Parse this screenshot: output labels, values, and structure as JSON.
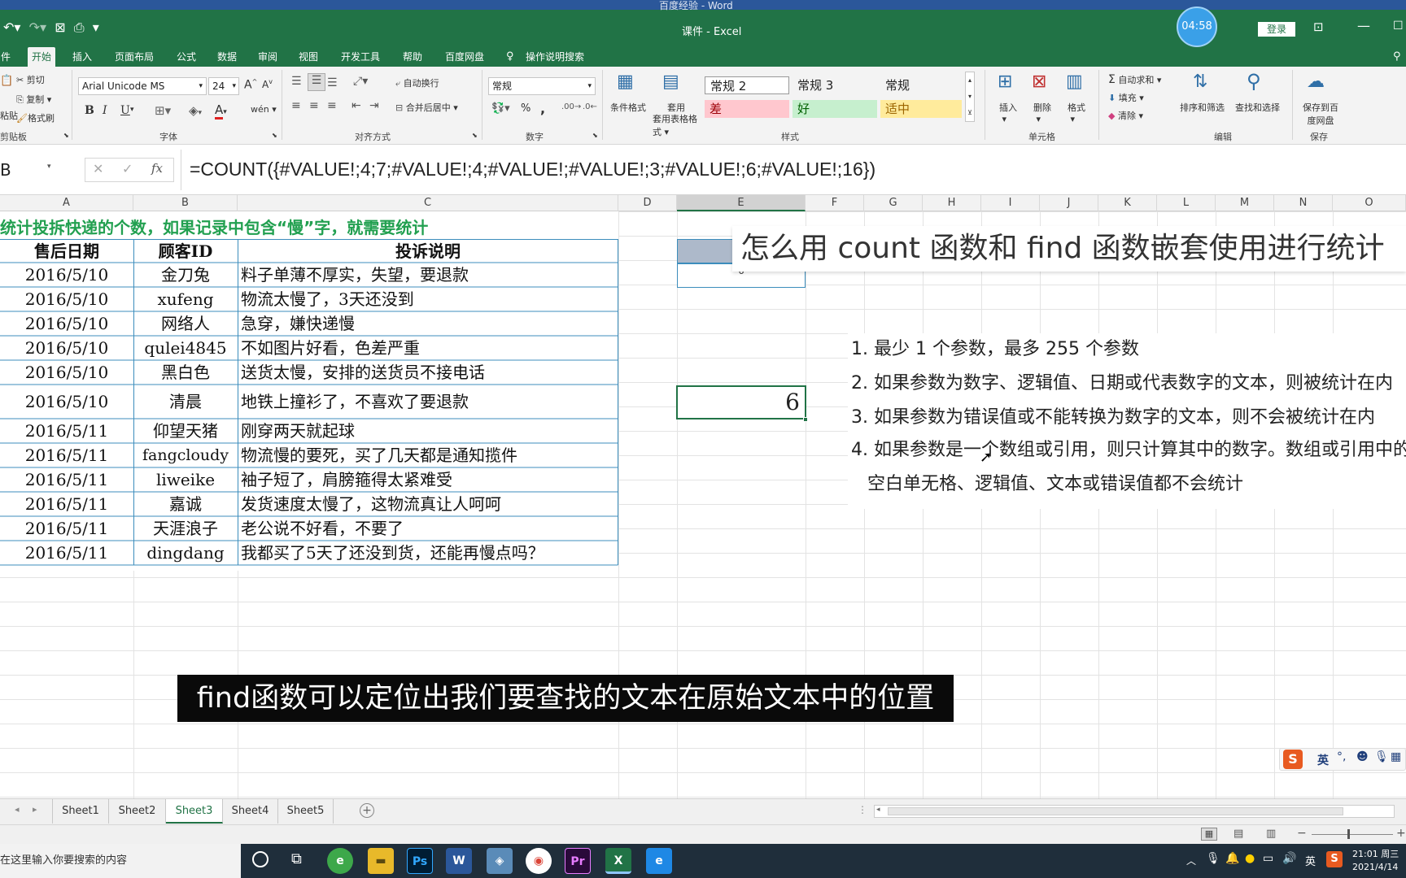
{
  "window": {
    "behind_title": "百度经验 - Word",
    "title": "课件  -  Excel",
    "timer": "04:58",
    "login": "登录"
  },
  "ribbon_tabs": [
    "件",
    "开始",
    "插入",
    "页面布局",
    "公式",
    "数据",
    "审阅",
    "视图",
    "开发工具",
    "帮助",
    "百度网盘",
    "操作说明搜索"
  ],
  "clipboard": {
    "cut": "剪切",
    "copy": "复制",
    "painter": "格式刷",
    "paste": "粘贴",
    "group": "剪贴板"
  },
  "font": {
    "name": "Arial Unicode MS",
    "size": "24",
    "bold": "B",
    "italic": "I",
    "underline": "U",
    "font_color_glyph": "A",
    "phonetic": "wén",
    "group": "字体"
  },
  "alignment": {
    "wrap": "自动换行",
    "merge": "合并后居中",
    "group": "对齐方式"
  },
  "number": {
    "format": "常规",
    "percent": "%",
    "comma": ",",
    "group": "数字"
  },
  "styles": {
    "conditional": "条件格式",
    "table_format": "套用表格格式",
    "group": "样式",
    "cells": [
      {
        "label": "常规 2",
        "bg": "#ffffff",
        "fg": "#222222"
      },
      {
        "label": "常规 3",
        "bg": "#f3f3f3",
        "fg": "#222222"
      },
      {
        "label": "常规",
        "bg": "#f3f3f3",
        "fg": "#222222"
      },
      {
        "label": "差",
        "bg": "#ffc7ce",
        "fg": "#9c0006"
      },
      {
        "label": "好",
        "bg": "#c6efce",
        "fg": "#006100"
      },
      {
        "label": "适中",
        "bg": "#ffeb9c",
        "fg": "#9c6500"
      }
    ]
  },
  "cells_group": {
    "insert": "插入",
    "delete": "删除",
    "format": "格式",
    "group": "单元格"
  },
  "editing": {
    "autosum": "自动求和",
    "fill": "填充",
    "clear": "清除",
    "sort": "排序和筛选",
    "find": "查找和选择",
    "group": "编辑"
  },
  "save_group": {
    "save_to": "保存到百度网盘",
    "group": "保存"
  },
  "formula_bar": {
    "name_box": "B",
    "cancel": "✕",
    "enter": "✓",
    "fx": "fx",
    "formula": "=COUNT({#VALUE!;4;7;#VALUE!;4;#VALUE!;#VALUE!;3;#VALUE!;6;#VALUE!;16})"
  },
  "columns": [
    "A",
    "B",
    "C",
    "D",
    "E",
    "F",
    "G",
    "H",
    "I",
    "J",
    "K",
    "L",
    "M",
    "N",
    "O"
  ],
  "sheet": {
    "heading": "统计投拆快递的个数，如果记录中包含“慢”字，就需要统计",
    "headers": [
      "售后日期",
      "顾客ID",
      "投诉说明"
    ],
    "rows": [
      [
        "2016/5/10",
        "金刀兔",
        "料子单薄不厚实，失望，要退款"
      ],
      [
        "2016/5/10",
        "xufeng",
        "物流太慢了，3天还没到"
      ],
      [
        "2016/5/10",
        "网络人",
        "急穿，嫌快递慢"
      ],
      [
        "2016/5/10",
        "qulei4845",
        "不如图片好看，色差严重"
      ],
      [
        "2016/5/10",
        "黑白色",
        "送货太慢，安排的送货员不接电话"
      ],
      [
        "2016/5/10",
        "清晨",
        "地铁上撞衫了，不喜欢了要退款"
      ],
      [
        "2016/5/11",
        "仰望天猪",
        "刚穿两天就起球"
      ],
      [
        "2016/5/11",
        "fangcloudy",
        "物流慢的要死，买了几天都是通知揽件"
      ],
      [
        "2016/5/11",
        "liweike",
        "袖子短了，肩膀箍得太紧难受"
      ],
      [
        "2016/5/11",
        "嘉诚",
        "发货速度太慢了，这物流真让人呵呵"
      ],
      [
        "2016/5/11",
        "天涯浪子",
        "老公说不好看，不要了"
      ],
      [
        "2016/5/11",
        "dingdang",
        "我都买了5天了还没到货，还能再慢点吗？"
      ]
    ],
    "e_small_value": "6",
    "result": "6"
  },
  "overlay": {
    "title": "怎么用 count 函数和 find 函数嵌套使用进行统计",
    "notes": [
      "1. 最少 1 个参数，最多 255 个参数",
      "2. 如果参数为数字、逻辑值、日期或代表数字的文本，则被统计在内",
      "3. 如果参数为错误值或不能转换为数字的文本，则不会被统计在内",
      "4. 如果参数是一个数组或引用，则只计算其中的数字。数组或引用中的",
      "空白单无格、逻辑值、文本或错误值都不会统计"
    ],
    "subtitle": "find函数可以定位出我们要查找的文本在原始文本中的位置"
  },
  "ime": {
    "lang": "英"
  },
  "sheet_tabs": [
    "Sheet1",
    "Sheet2",
    "Sheet3",
    "Sheet4",
    "Sheet5"
  ],
  "active_sheet": "Sheet3",
  "taskbar": {
    "search": "在这里输入你要搜索的内容",
    "time": "21:01 周三",
    "date": "2021/4/14",
    "lang": "英"
  }
}
